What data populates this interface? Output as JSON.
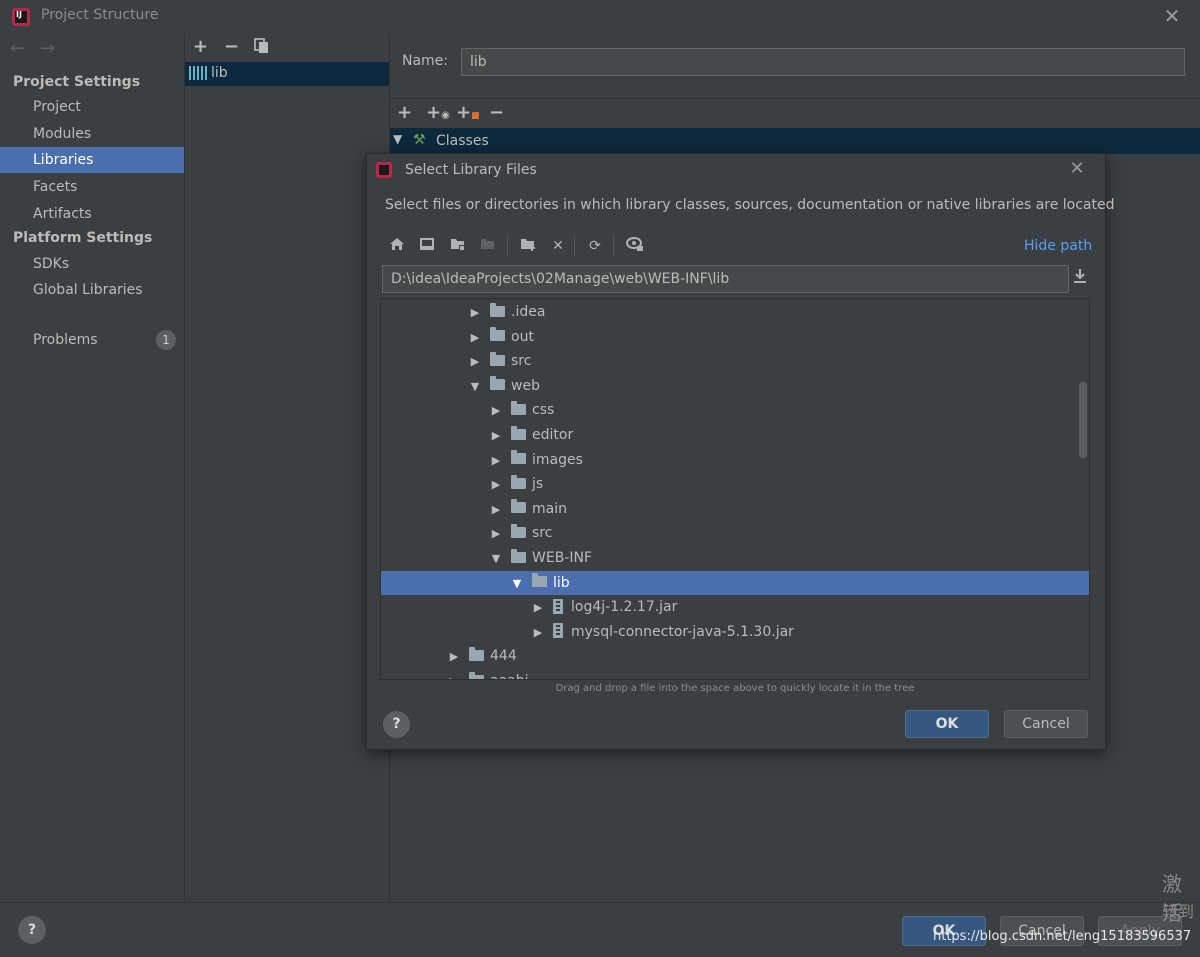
{
  "window": {
    "title": "Project Structure"
  },
  "sidebar": {
    "project_settings_header": "Project Settings",
    "project_items": [
      "Project",
      "Modules",
      "Libraries",
      "Facets",
      "Artifacts"
    ],
    "platform_settings_header": "Platform Settings",
    "platform_items": [
      "SDKs",
      "Global Libraries"
    ],
    "problems_label": "Problems",
    "problems_count": "1",
    "selected": "Libraries"
  },
  "library_list": {
    "items": [
      "lib"
    ]
  },
  "detail": {
    "name_label": "Name:",
    "name_value": "lib",
    "classes_label": "Classes"
  },
  "main_buttons": {
    "help": "?",
    "ok": "OK",
    "cancel": "Cancel",
    "apply": "Apply"
  },
  "dialog": {
    "title": "Select Library Files",
    "description": "Select files or directories in which library classes, sources, documentation or native libraries are located",
    "hide_path": "Hide path",
    "path": "D:\\idea\\IdeaProjects\\02Manage\\web\\WEB-INF\\lib",
    "drag_hint": "Drag and drop a file into the space above to quickly locate it in the tree",
    "help": "?",
    "ok": "OK",
    "cancel": "Cancel",
    "tree": [
      {
        "label": ".idea",
        "depth": 0,
        "expanded": false,
        "kind": "folder"
      },
      {
        "label": "out",
        "depth": 0,
        "expanded": false,
        "kind": "folder"
      },
      {
        "label": "src",
        "depth": 0,
        "expanded": false,
        "kind": "folder"
      },
      {
        "label": "web",
        "depth": 0,
        "expanded": true,
        "kind": "folder"
      },
      {
        "label": "css",
        "depth": 1,
        "expanded": false,
        "kind": "folder"
      },
      {
        "label": "editor",
        "depth": 1,
        "expanded": false,
        "kind": "folder"
      },
      {
        "label": "images",
        "depth": 1,
        "expanded": false,
        "kind": "folder"
      },
      {
        "label": "js",
        "depth": 1,
        "expanded": false,
        "kind": "folder"
      },
      {
        "label": "main",
        "depth": 1,
        "expanded": false,
        "kind": "folder"
      },
      {
        "label": "src",
        "depth": 1,
        "expanded": false,
        "kind": "folder"
      },
      {
        "label": "WEB-INF",
        "depth": 1,
        "expanded": true,
        "kind": "folder"
      },
      {
        "label": "lib",
        "depth": 2,
        "expanded": true,
        "kind": "folder",
        "selected": true
      },
      {
        "label": "log4j-1.2.17.jar",
        "depth": 3,
        "expanded": false,
        "kind": "jar"
      },
      {
        "label": "mysql-connector-java-5.1.30.jar",
        "depth": 3,
        "expanded": false,
        "kind": "jar"
      },
      {
        "label": "444",
        "depth": -1,
        "expanded": false,
        "kind": "folder"
      },
      {
        "label": "aaabi",
        "depth": -1,
        "expanded": false,
        "kind": "folder"
      }
    ]
  },
  "overlay": {
    "side_chars_1": "激活",
    "side_chars_2": "转到",
    "watermark": "https://blog.csdn.net/leng15183596537"
  }
}
